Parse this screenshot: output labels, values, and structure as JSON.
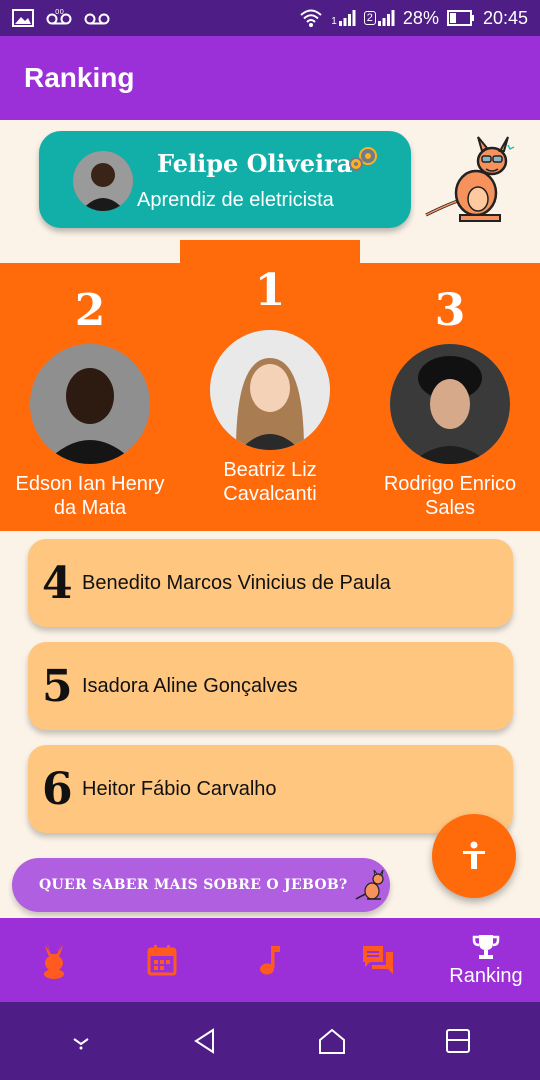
{
  "status_bar": {
    "battery": "28%",
    "time": "20:45",
    "sim_badge": "2",
    "sim_small": "1",
    "icons": [
      "image-icon",
      "voicemail-icon",
      "voicemail-icon",
      "wifi-icon",
      "signal-icon",
      "signal-icon",
      "battery-icon"
    ]
  },
  "app_bar": {
    "title": "Ranking"
  },
  "profile": {
    "name": "Felipe Oliveira",
    "role": "Aprendiz de eletricista"
  },
  "podium": [
    {
      "rank": "2",
      "name": "Edson Ian Henry da Mata"
    },
    {
      "rank": "1",
      "name": "Beatriz Liz Cavalcanti"
    },
    {
      "rank": "3",
      "name": "Rodrigo Enrico Sales"
    }
  ],
  "ranking_list": [
    {
      "rank": "4",
      "name": "Benedito Marcos Vinicius de Paula"
    },
    {
      "rank": "5",
      "name": "Isadora Aline Gonçalves"
    },
    {
      "rank": "6",
      "name": "Heitor Fábio Carvalho"
    }
  ],
  "info_banner": {
    "text": "QUER SABER MAIS SOBRE O JEBOB?"
  },
  "bottom_nav": {
    "items": [
      {
        "icon": "rabbit-icon"
      },
      {
        "icon": "calendar-icon"
      },
      {
        "icon": "music-note-icon"
      },
      {
        "icon": "chat-icon"
      },
      {
        "icon": "trophy-icon",
        "label": "Ranking"
      }
    ]
  },
  "colors": {
    "status_bar": "#4E1D86",
    "app_bar": "#9B30D9",
    "teal": "#12AFA8",
    "orange": "#FF6A0A",
    "card": "#FFC680",
    "background": "#FBF3E8"
  }
}
